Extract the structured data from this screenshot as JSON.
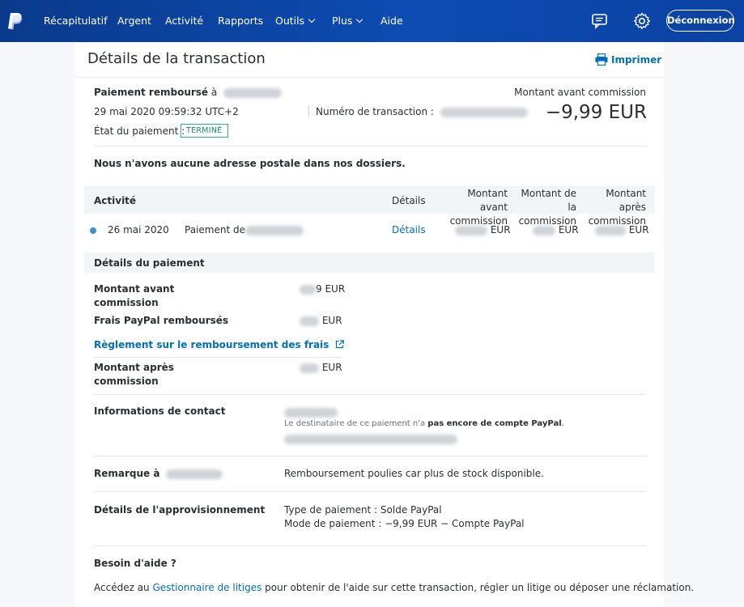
{
  "nav": {
    "items": [
      "Récapitulatif",
      "Argent",
      "Activité",
      "Rapports",
      "Outils",
      "Plus",
      "Aide"
    ],
    "logout": "Déconnexion",
    "icons": [
      "paypal-logo",
      "message-center-icon",
      "settings-icon"
    ]
  },
  "page": {
    "title": "Détails de la transaction",
    "print": "Imprimer"
  },
  "summary": {
    "status_prefix": "Paiement remboursé",
    "status_suffix": " à",
    "date": "29 mai 2020 09:59:32 UTC+2",
    "txn_label": "Numéro de transaction :",
    "state_label": "État du paiement :",
    "state_badge": "TERMINÉ",
    "amount_label": "Montant avant commission",
    "amount": "−9,99 EUR"
  },
  "address_notice": "Nous n'avons aucune adresse postale dans nos dossiers.",
  "activity": {
    "headers": {
      "activity": "Activité",
      "details": "Détails",
      "gross_line1": "Montant avant",
      "gross_line2": "commission",
      "fee_line1": "Montant de la",
      "fee_line2": "commission",
      "net_line1": "Montant après",
      "net_line2": "commission"
    },
    "row": {
      "date": "26 mai 2020",
      "desc": "Paiement de",
      "details_link": "Détails",
      "gross_visible": "EUR",
      "fee_visible": "EUR",
      "net_visible": "EUR"
    }
  },
  "payment_details": {
    "section_title": "Détails du paiement",
    "gross_label_1": "Montant avant",
    "gross_label_2": "commission",
    "gross_value_tail": "9 EUR",
    "fees_label": "Frais PayPal remboursés",
    "fees_value": "EUR",
    "policy_link": "Règlement sur le remboursement des frais",
    "net_label_1": "Montant après",
    "net_label_2": "commission",
    "net_value": "EUR"
  },
  "contact": {
    "label": "Informations de contact",
    "note_prefix": "Le destinataire de ce paiement n'a ",
    "note_bold": "pas encore de compte PayPal",
    "note_suffix": "."
  },
  "remark": {
    "label": "Remarque à",
    "text": "Remboursement poulies car plus de stock disponible."
  },
  "funding": {
    "label": "Détails de l'approvisionnement",
    "line1": "Type de paiement : Solde PayPal",
    "line2": "Mode de paiement : −9,99 EUR − Compte PayPal"
  },
  "help": {
    "title": "Besoin d'aide ?",
    "prefix": "Accédez au ",
    "link": "Gestionnaire de litiges",
    "suffix": " pour obtenir de l'aide sur cette transaction, régler un litige ou déposer une réclamation."
  }
}
